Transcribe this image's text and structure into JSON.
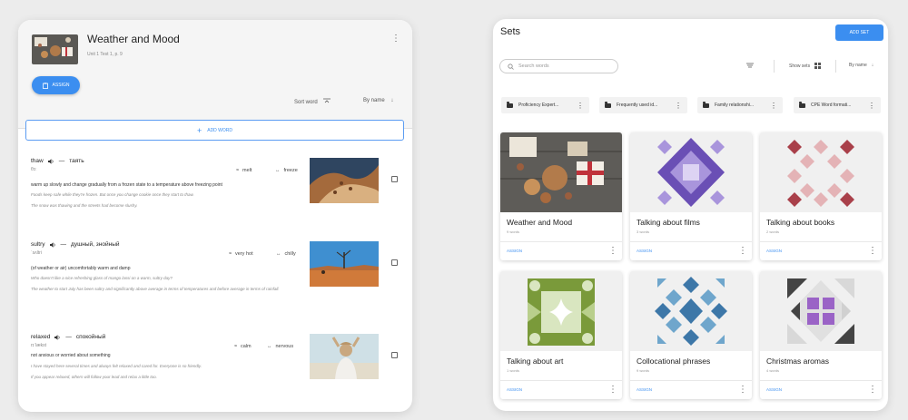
{
  "left": {
    "title": "Weather and Mood",
    "subtitle": "Unit 1 Test 1, p. 9",
    "assign_label": "ASSIGN",
    "sort_word": "Sort word",
    "by_name": "By name",
    "add_word": "ADD WORD",
    "entries": [
      {
        "word": "thaw",
        "translation": "таять",
        "transcription": "θɔː",
        "synonym": "melt",
        "antonym": "freeze",
        "definition": "warm up slowly and change gradually from a frozen state to a temperature above freezing point",
        "examples": [
          "Foods keep safe while they're frozen. But once you change cookie once they start to thaw.",
          "The snow was thawing and the streets had become slushy."
        ]
      },
      {
        "word": "sultry",
        "translation": "душный, знойный",
        "transcription": "ˈsʌltri",
        "synonym": "very hot",
        "antonym": "chilly",
        "definition": "(of weather or air) uncomfortably warm and damp",
        "examples": [
          "Who doesn't like a nice refreshing glass of mango lassi on a warm, sultry day?",
          "The weather to start July has been sultry and significantly above average in terms of temperatures and before average in terms of rainfall."
        ]
      },
      {
        "word": "relaxed",
        "translation": "спокойный",
        "transcription": "rɪˈlækst",
        "synonym": "calm",
        "antonym": "nervous",
        "definition": "not anxious or worried about something",
        "examples": [
          "I have stayed here several times and always felt relaxed and cared for. Everyone is so friendly.",
          "If you appear relaxed, others will follow your lead and relax a little too."
        ]
      }
    ]
  },
  "right": {
    "title": "Sets",
    "add_set": "ADD SET",
    "search_placeholder": "Search words",
    "show_sets": "Show sets",
    "by_name": "By name",
    "folders": [
      "Proficiency Expert...",
      "Frequently used id...",
      "Family relationshi...",
      "CPE Word formati..."
    ],
    "cards": [
      {
        "title": "Weather and Mood",
        "count": "9 words",
        "assign": "ASSIGN"
      },
      {
        "title": "Talking about films",
        "count": "3 words",
        "assign": "ASSIGN"
      },
      {
        "title": "Talking about books",
        "count": "2 words",
        "assign": "ASSIGN"
      },
      {
        "title": "Talking about art",
        "count": "1 words",
        "assign": "ASSIGN"
      },
      {
        "title": "Collocational phrases",
        "count": "9 words",
        "assign": "ASSIGN"
      },
      {
        "title": "Christmas aromas",
        "count": "4 words",
        "assign": "ASSIGN"
      }
    ]
  },
  "colors": {
    "accent": "#3b8ef0",
    "films_purple": "#6a4fb5",
    "books_red": "#a9404a",
    "art_green": "#7a9a3a",
    "collocation_blue": "#3d77a8",
    "christmas_gray": "#444444"
  }
}
